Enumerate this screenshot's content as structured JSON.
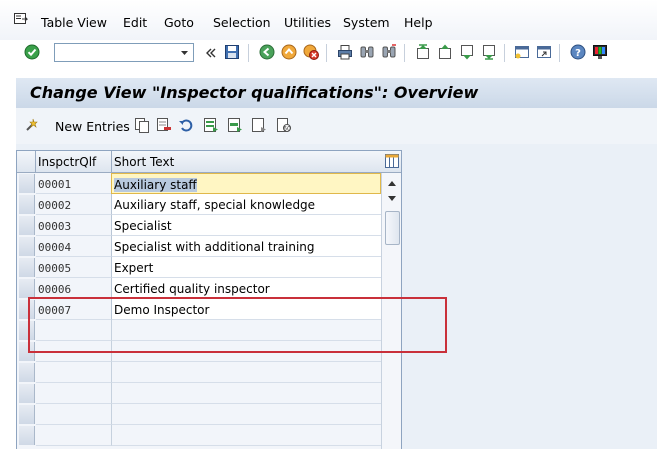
{
  "menu": {
    "items": [
      "Table View",
      "Edit",
      "Goto",
      "Selection",
      "Utilities",
      "System",
      "Help"
    ]
  },
  "toolbar": {
    "command_field_value": "",
    "icons": [
      "enter-icon",
      "command-dropdown-icon",
      "collapse-icon",
      "save-icon",
      "back-icon",
      "exit-icon",
      "cancel-icon",
      "print-icon",
      "find-icon",
      "find-next-icon",
      "first-page-icon",
      "previous-page-icon",
      "next-page-icon",
      "last-page-icon",
      "new-session-icon",
      "shortcut-icon",
      "help-icon",
      "layout-menu-icon"
    ]
  },
  "title": "Change View \"Inspector qualifications\": Overview",
  "app_toolbar": {
    "new_entries_label": "New Entries"
  },
  "table": {
    "columns": [
      "InspctrQlf",
      "Short Text"
    ],
    "rows": [
      {
        "key": "00001",
        "text": "Auxiliary staff"
      },
      {
        "key": "00002",
        "text": "Auxiliary staff, special knowledge"
      },
      {
        "key": "00003",
        "text": "Specialist"
      },
      {
        "key": "00004",
        "text": "Specialist with additional training"
      },
      {
        "key": "00005",
        "text": "Expert"
      },
      {
        "key": "00006",
        "text": "Certified quality inspector"
      },
      {
        "key": "00007",
        "text": "Demo Inspector"
      }
    ]
  },
  "colors": {
    "title_bar": "#cbd8e8",
    "active_cell": "#fff6c3",
    "highlight_box": "#c9303a"
  }
}
